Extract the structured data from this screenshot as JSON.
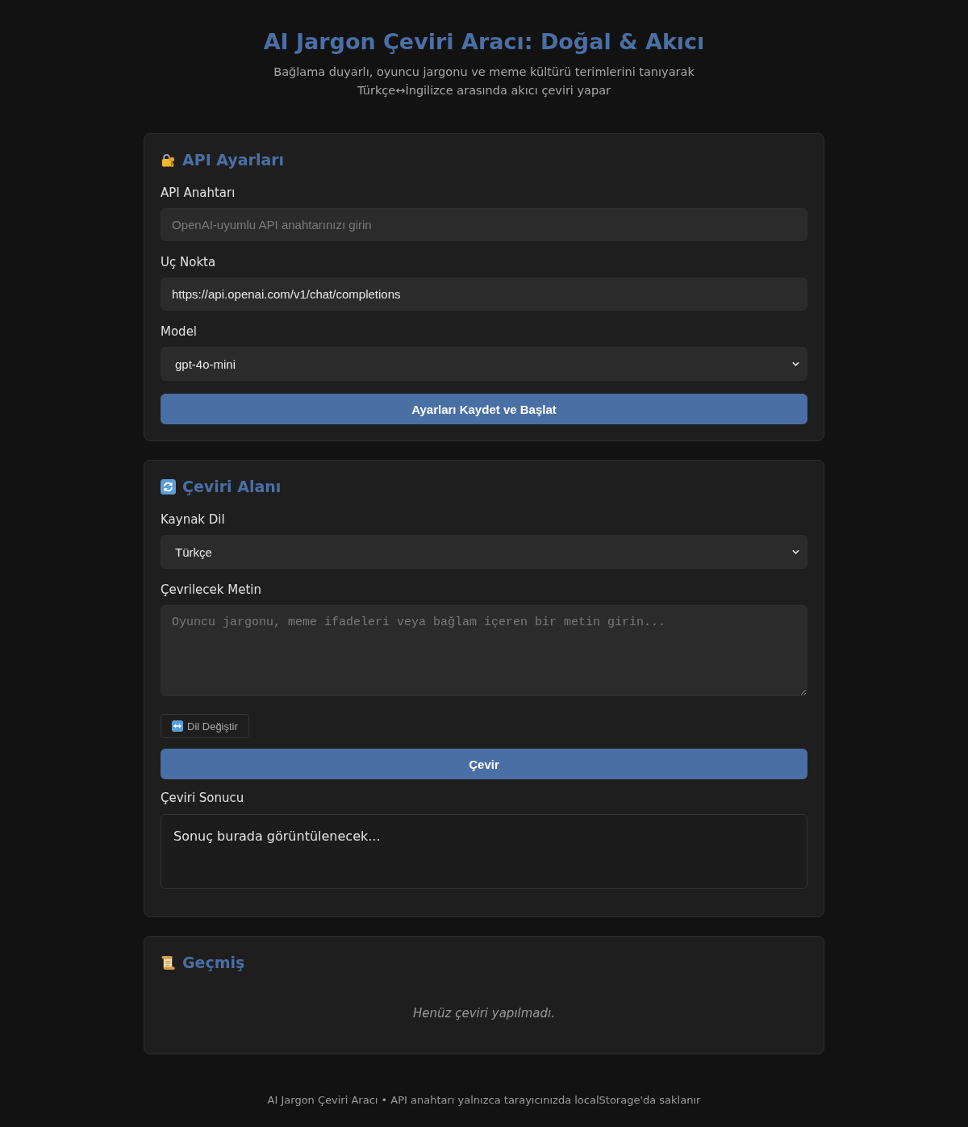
{
  "header": {
    "title": "AI Jargon Çeviri Aracı: Doğal & Akıcı",
    "subtitle": "Bağlama duyarlı, oyuncu jargonu ve meme kültürü terimlerini tanıyarak Türkçe↔İngilizce arasında akıcı çeviri yapar"
  },
  "settings": {
    "heading": "API Ayarları",
    "fields": [
      {
        "kind": "input",
        "label": "API Anahtarı",
        "placeholder": "OpenAI-uyumlu API anahtarınızı girin"
      },
      {
        "kind": "input",
        "label": "Uç Nokta",
        "value": "https://api.openai.com/v1/chat/completions"
      },
      {
        "kind": "select",
        "label": "Model",
        "value": "gpt-4o-mini"
      }
    ],
    "button": "Ayarları Kaydet ve Başlat"
  },
  "translation": {
    "heading": "Çeviri Alanı",
    "source_language": {
      "label": "Kaynak Dil",
      "value": "Türkçe"
    },
    "source_text": {
      "label": "Çevrilecek Metin",
      "placeholder": "Oyuncu jargonu, meme ifadeleri veya bağlam içeren bir metin girin..."
    },
    "swap_button": "Dil Değiştir",
    "translate_button": "Çevir",
    "result": {
      "label": "Çeviri Sonucu",
      "text": "Sonuç burada görüntülenecek..."
    }
  },
  "history": {
    "heading": "Geçmiş",
    "empty_text": "Henüz çeviri yapılmadı."
  },
  "footer": "AI Jargon Çeviri Aracı • API anahtarı yalnızca tarayıcınızda localStorage'da saklanır"
}
